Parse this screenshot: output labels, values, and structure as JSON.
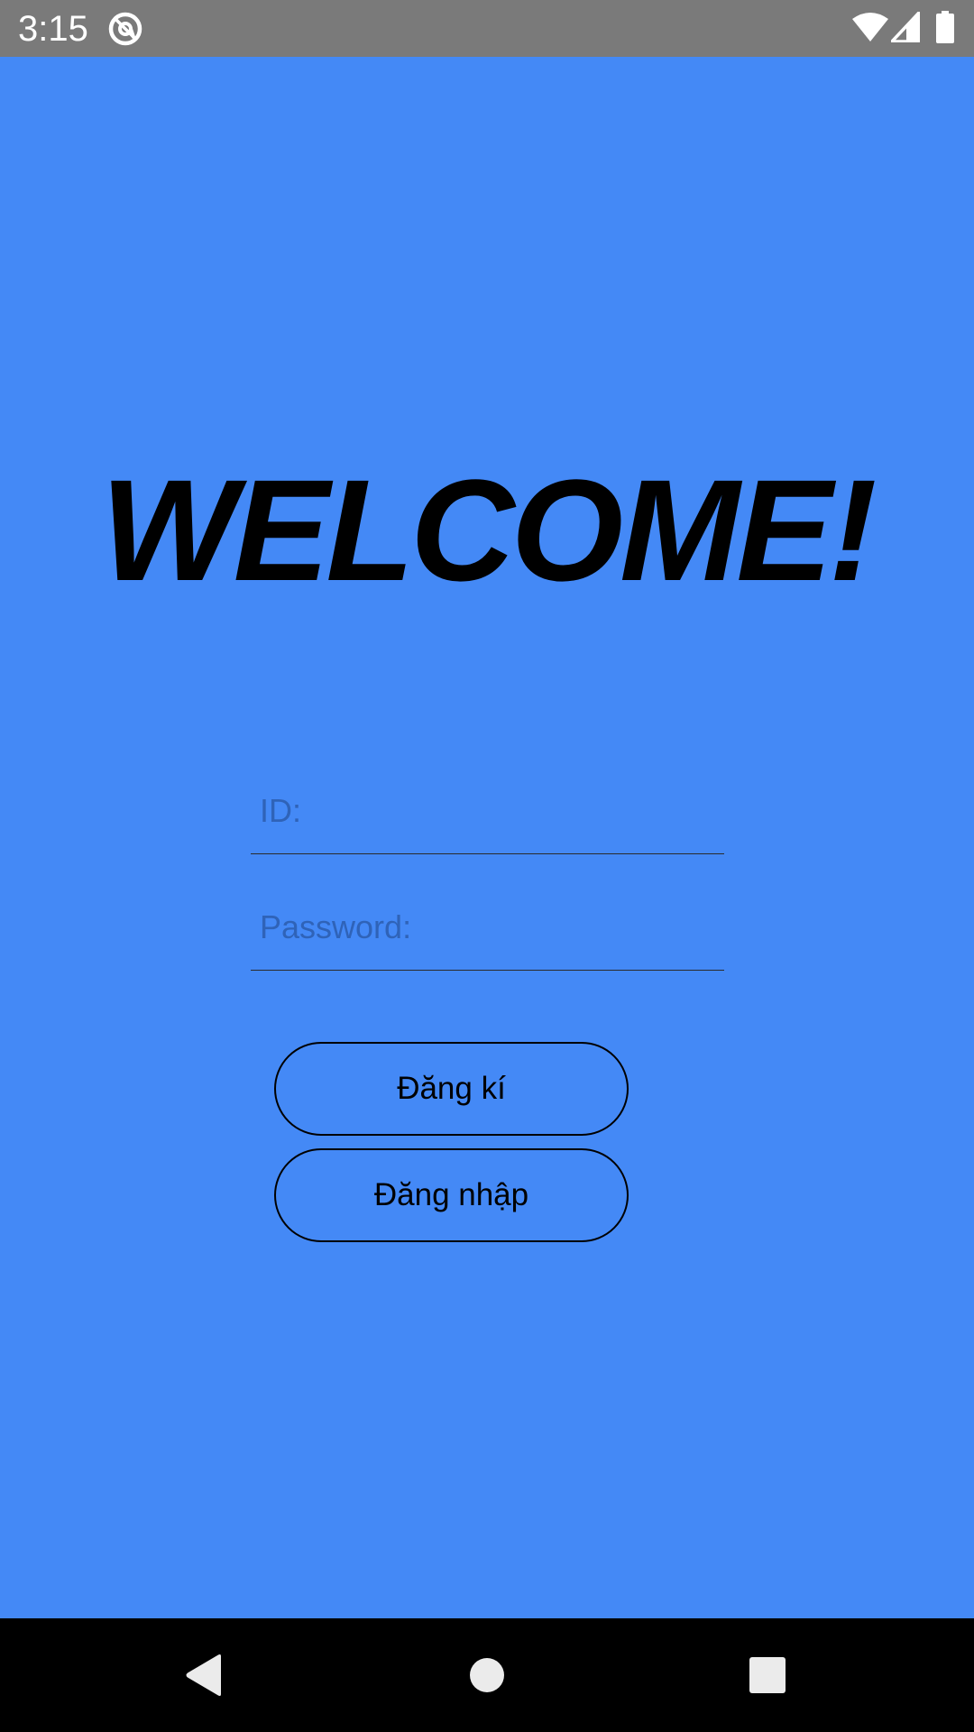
{
  "status_bar": {
    "time": "3:15",
    "icons": [
      "at-sign-icon",
      "wifi-icon",
      "cellular-signal-icon",
      "battery-icon"
    ]
  },
  "app": {
    "background_color": "#4489f6",
    "welcome_text": "WELCOME!",
    "id_field": {
      "placeholder": "ID:",
      "value": ""
    },
    "password_field": {
      "placeholder": "Password:",
      "value": ""
    },
    "register_button": "Đăng kí",
    "login_button": "Đăng nhập"
  },
  "nav_bar": {
    "icons": [
      "back-icon",
      "home-icon",
      "recents-icon"
    ]
  }
}
